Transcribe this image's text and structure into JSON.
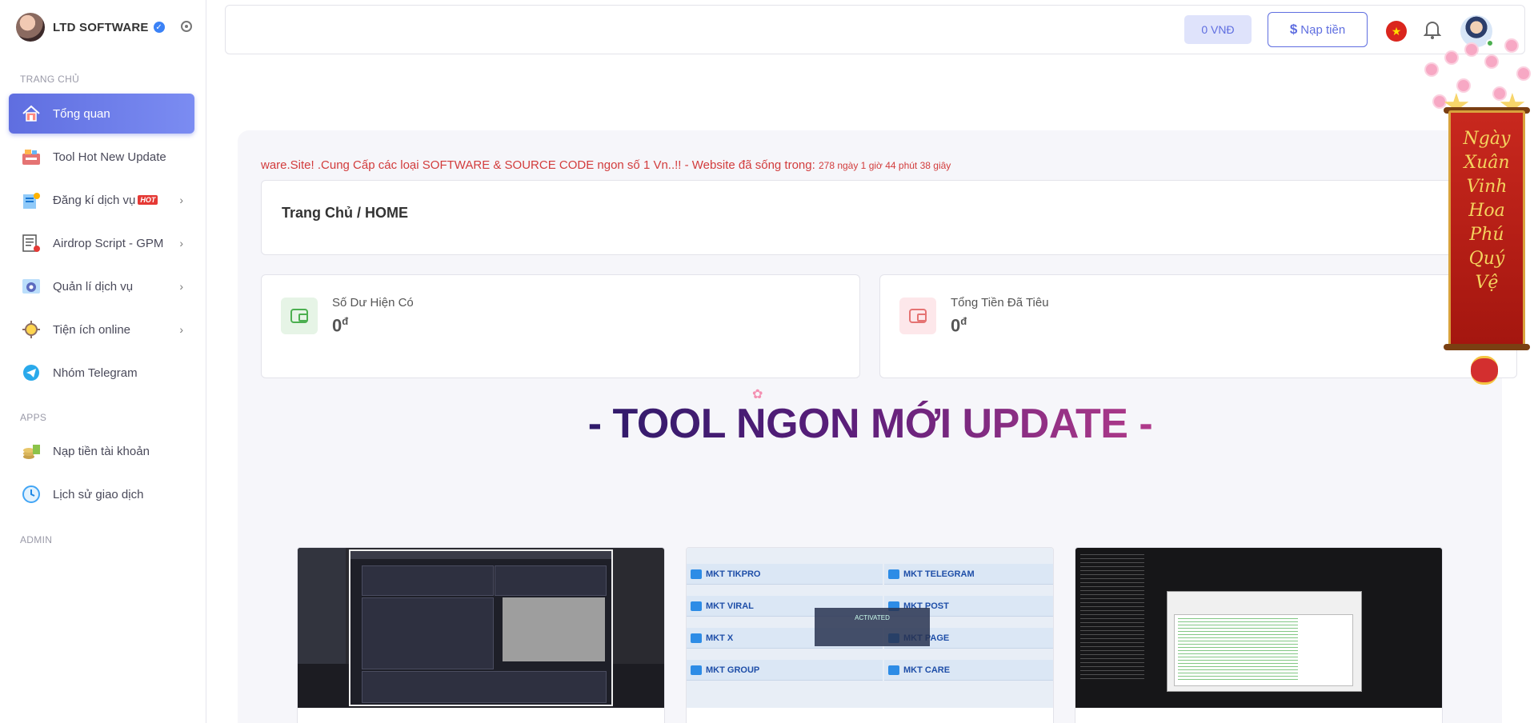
{
  "brand": {
    "name": "LTD SOFTWARE"
  },
  "sidebar": {
    "sections": [
      {
        "label": "TRANG CHỦ"
      },
      {
        "label": "APPS"
      },
      {
        "label": "ADMIN"
      }
    ],
    "items": [
      {
        "label": "Tổng quan",
        "icon": "home-icon",
        "active": true
      },
      {
        "label": "Tool Hot New Update",
        "icon": "tool-icon"
      },
      {
        "label": "Đăng kí dịch vụ",
        "badge": "HOT",
        "icon": "register-icon",
        "has_submenu": true
      },
      {
        "label": "Airdrop Script - GPM",
        "icon": "script-icon",
        "has_submenu": true
      },
      {
        "label": "Quản lí dịch vụ",
        "icon": "manage-icon",
        "has_submenu": true
      },
      {
        "label": "Tiện ích online",
        "icon": "utility-icon",
        "has_submenu": true
      },
      {
        "label": "Nhóm Telegram",
        "icon": "telegram-icon"
      },
      {
        "label": "Nạp tiền tài khoản",
        "icon": "deposit-icon"
      },
      {
        "label": "Lịch sử giao dịch",
        "icon": "history-icon"
      }
    ]
  },
  "topbar": {
    "balance": "0 VNĐ",
    "topup_label": "Nạp tiền",
    "language": "vn-flag-icon"
  },
  "main": {
    "marquee": "ware.Site! .Cung Cấp các loại SOFTWARE & SOURCE CODE ngon số 1 Vn..!! - Website đã sống trong:",
    "uptime": "278 ngày 1 giờ 44 phút 38 giây",
    "breadcrumb": "Trang Chủ / HOME",
    "stats": [
      {
        "label": "Số Dư Hiện Có",
        "value": "0",
        "unit": "đ",
        "color": "#4caf50"
      },
      {
        "label": "Tổng Tiền Đã Tiêu",
        "value": "0",
        "unit": "đ",
        "color": "#e57373"
      }
    ],
    "section_title": "- TOOL NGON MỚI UPDATE -",
    "mkt_labels": [
      "MKT TIKPRO",
      "MKT TELEGRAM",
      "MKT VIRAL",
      "MKT POST",
      "MKT X",
      "MKT PAGE",
      "MKT GROUP",
      "MKT CARE"
    ],
    "activated_text": "ACTIVATED"
  },
  "decor": {
    "banner_text": [
      "Ngày",
      "Xuân",
      "Vinh",
      "Hoa",
      "Phú",
      "Quý",
      "Vệ"
    ]
  },
  "colors": {
    "accent": "#5f6ee0",
    "marquee": "#d23c3c",
    "title_gradient_start": "#2e1a6a",
    "title_gradient_end": "#b03a8a"
  }
}
